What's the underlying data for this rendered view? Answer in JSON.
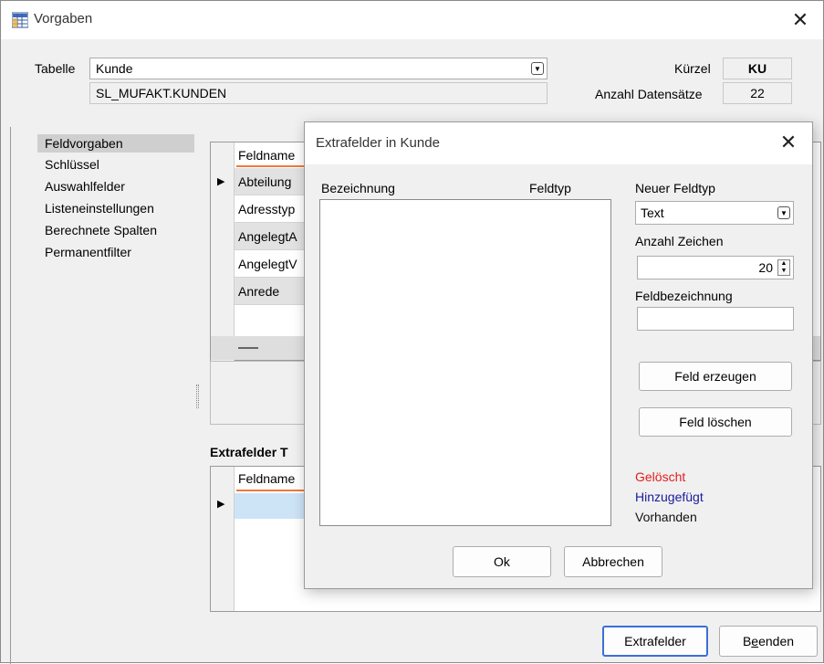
{
  "window": {
    "title": "Vorgaben"
  },
  "header": {
    "tabelle_label": "Tabelle",
    "tabelle_value": "Kunde",
    "table_path": "SL_MUFAKT.KUNDEN",
    "kuerzel_label": "Kürzel",
    "kuerzel_value": "KU",
    "anzahl_label": "Anzahl Datensätze",
    "anzahl_value": "22"
  },
  "sidebar": {
    "items": [
      {
        "label": "Feldvorgaben"
      },
      {
        "label": "Schlüssel"
      },
      {
        "label": "Auswahlfelder"
      },
      {
        "label": "Listeneinstellungen"
      },
      {
        "label": "Berechnete Spalten"
      },
      {
        "label": "Permanentfilter"
      }
    ]
  },
  "main_grid": {
    "header": "Feldname",
    "rows": [
      "Abteilung",
      "Adresstyp",
      "AngelegtA",
      "AngelegtV",
      "Anrede"
    ]
  },
  "extrafelder": {
    "section_title": "Extrafelder T",
    "header": "Feldname"
  },
  "footer": {
    "extrafelder_button": "Extrafelder",
    "beenden_button": "Beenden",
    "beenden_mnemonic_prefix": "B",
    "beenden_mnemonic_char": "e",
    "beenden_mnemonic_suffix": "enden"
  },
  "dialog": {
    "title": "Extrafelder in Kunde",
    "col_bezeichnung": "Bezeichnung",
    "col_feldtyp": "Feldtyp",
    "neuer_feldtyp_label": "Neuer Feldtyp",
    "neuer_feldtyp_value": "Text",
    "anzahl_zeichen_label": "Anzahl Zeichen",
    "anzahl_zeichen_value": "20",
    "feldbezeichnung_label": "Feldbezeichnung",
    "feldbezeichnung_value": "",
    "feld_erzeugen_button": "Feld erzeugen",
    "feld_loeschen_button": "Feld löschen",
    "legend": [
      {
        "label": "Gelöscht",
        "color": "#e0201c"
      },
      {
        "label": "Hinzugefügt",
        "color": "#1a1a9c"
      },
      {
        "label": "Vorhanden",
        "color": "#111111"
      }
    ],
    "ok_button": "Ok",
    "abbrechen_button": "Abbrechen"
  }
}
